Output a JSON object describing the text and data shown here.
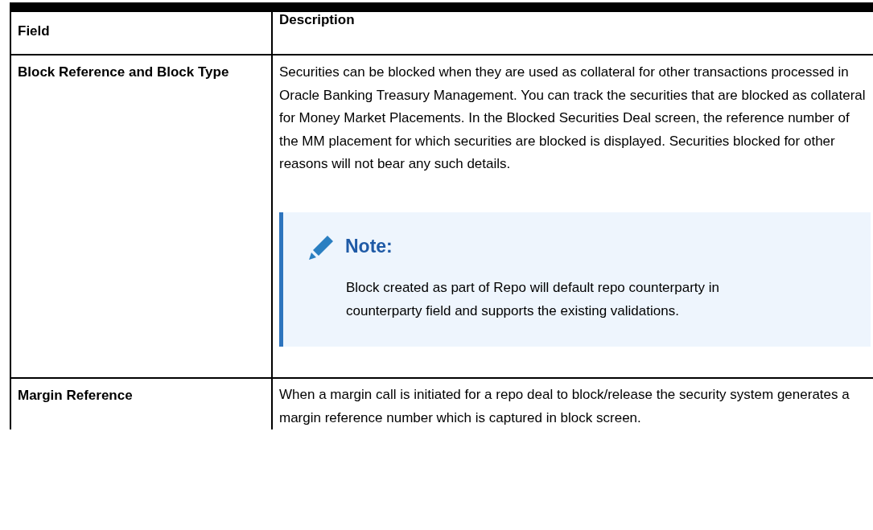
{
  "table": {
    "columns": [
      "Field",
      "Description"
    ],
    "rows": [
      {
        "field": "Block Reference and Block Type",
        "description": "Securities can be blocked when they are used as collateral for other transactions processed in Oracle Banking Treasury Management. You can track the securities that are blocked as collateral for Money Market Placements. In the Blocked Securities Deal screen, the reference number of the MM placement for which securities are blocked is displayed. Securities blocked for other reasons will not bear any such details.",
        "note": {
          "title": "Note:",
          "text": "Block created as part of Repo will default repo counterparty in counterparty field and supports the existing validations."
        }
      },
      {
        "field": "Margin Reference",
        "description": "When a margin call is initiated for a repo deal to block/release the security system generates a margin reference number which is captured in block screen."
      }
    ]
  }
}
